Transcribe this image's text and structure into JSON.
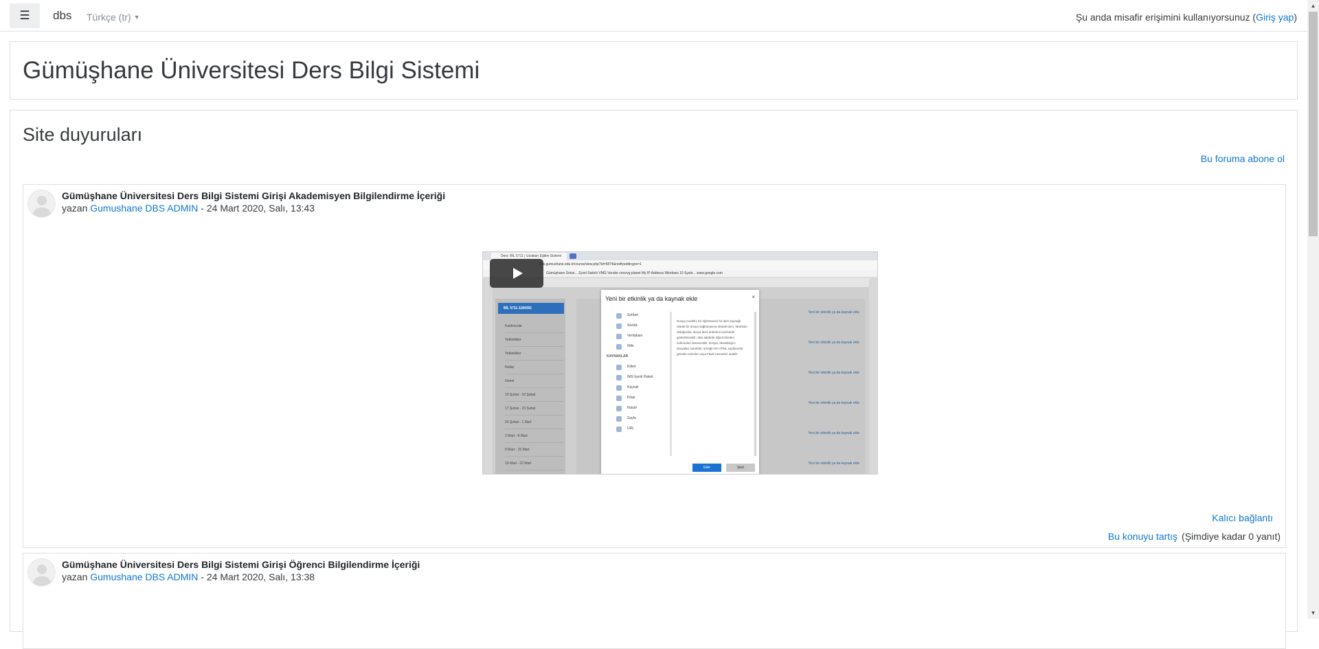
{
  "navbar": {
    "menu_icon": "hamburger-menu-icon",
    "brand": "dbs",
    "language": "Türkçe ‎(tr)‎",
    "guest_text": "Şu anda misafir erişimini kullanıyorsunuz (",
    "login_link": "Giriş yap",
    "guest_text_end": ")"
  },
  "header": {
    "title": "Gümüşhane Üniversitesi Ders Bilgi Sistemi"
  },
  "announcements": {
    "title": "Site duyuruları",
    "subscribe_link": "Bu foruma abone ol",
    "posts": [
      {
        "subject": "Gümüşhane Üniversitesi Ders Bilgi Sistemi Girişi Akademisyen Bilgilendirme İçeriği",
        "by": "yazan ",
        "author": "Gumushane DBS ADMIN",
        "date": " - 24 Mart 2020, Salı, 13:43",
        "permalink": "Kalıcı bağlantı",
        "discuss": "Bu konuyu tartış",
        "replies": "(Şimdiye kadar 0 yanıt)",
        "video": {
          "tab_title": "Ders: BİL 5711 | Uzaktan Eğitim Sistemi",
          "url": "dbs.gumushane.edu.tr/course/view.php?id=5874&notifyeditingon=1",
          "bookmarks": "Gümüşhane Ünive...   Zyxel Switch   VMG Vendor   cmsrvg   planet   My IP Address   Windows 10 Syste...   www.google.com",
          "course_name": "BİL 5711-1184391",
          "sidebar_items": [
            "Katılımcılar",
            "Yetkinlikler",
            "Yetkinlikler",
            "Notlar",
            "Genel",
            "10 Şubat - 16 Şubat",
            "17 Şubat - 23 Şubat",
            "24 Şubat - 1 Mart",
            "2 Mart - 8 Mart",
            "9 Mart - 15 Mart",
            "16 Mart - 22 Mart"
          ],
          "modal_title": "Yeni bir etkinlik ya da kaynak ekle",
          "modal_items": [
            "Sohbet",
            "Sözlük",
            "Veritabanı",
            "Wiki"
          ],
          "modal_section": "KAYNAKLAR",
          "modal_resources": [
            "Etiket",
            "IMS İçerik Paketi",
            "Kaynak",
            "Kitap",
            "Klasör",
            "Sayfa",
            "URL"
          ],
          "modal_desc": "Dosya modülü, bir öğretmenin bir ders kaynağı olarak bir dosya sağlamasına olanak tanır. Mümkün olduğunda, dosya ders arabirimi içerisinde gösterilecektir; aksi takdirde öğrencilerden indirmeleri istenecektir. Dosya, destekleyici dosyaları içerebilir; örneğin bir HTML sayfasında gömülü resimler veya Flash nesneleri olabilir.",
          "add_button": "Ekle",
          "cancel_button": "İptal",
          "right_link": "Yeni bir etkinlik ya da kaynak ekle"
        }
      },
      {
        "subject": "Gümüşhane Üniversitesi Ders Bilgi Sistemi Girişi Öğrenci Bilgilendirme İçeriği",
        "by": "yazan ",
        "author": "Gumushane DBS ADMIN",
        "date": " - 24 Mart 2020, Salı, 13:38"
      }
    ]
  },
  "colors": {
    "link": "#1177d1",
    "text": "#373a3c",
    "border": "#dfdfdf"
  }
}
